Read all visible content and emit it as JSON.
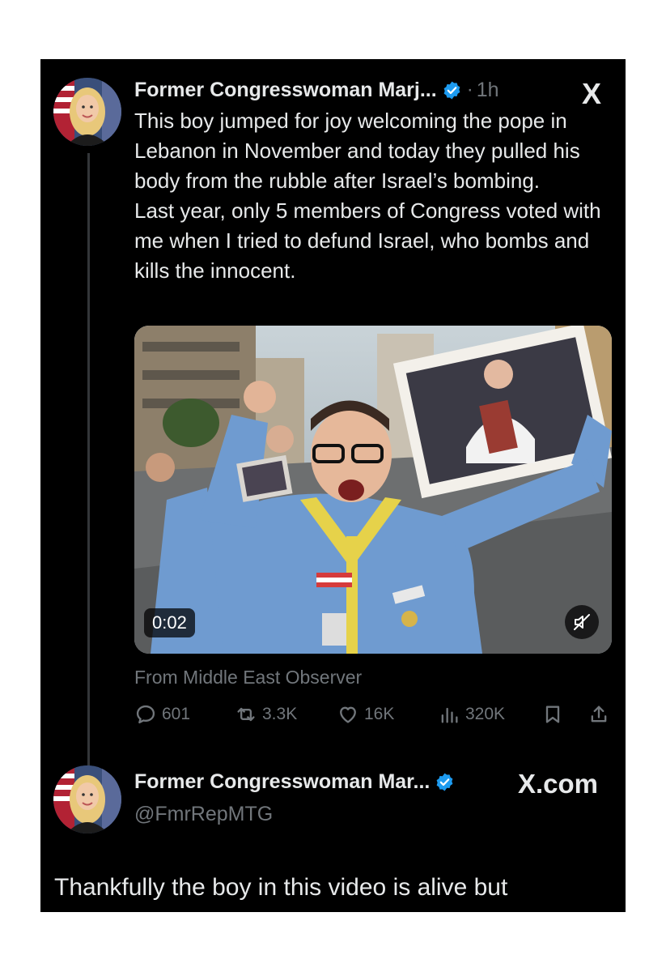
{
  "tweet": {
    "author_name": "Former Congresswoman Marj...",
    "time_separator": "·",
    "time": "1h",
    "app_logo": "X",
    "text": [
      "This boy jumped for joy welcoming the pope in Lebanon in November and today they pulled his body from the rubble after Israel’s bombing.",
      "Last year, only 5 members of Congress voted with me when I tried to defund Israel, who bombs and kills the innocent."
    ],
    "media": {
      "duration": "0:02",
      "mute_icon": "speaker-muted-icon"
    },
    "source": "From Middle East Observer",
    "actions": {
      "replies": "601",
      "reposts": "3.3K",
      "likes": "16K",
      "views": "320K"
    }
  },
  "quote": {
    "author_name": "Former Congresswoman Mar...",
    "site": "X.com",
    "handle": "@FmrRepMTG",
    "text": "Thankfully the boy in this video is alive but"
  },
  "colors": {
    "background": "#000000",
    "text": "#e7e9ea",
    "muted": "#71767b",
    "verified": "#1d9bf0"
  }
}
